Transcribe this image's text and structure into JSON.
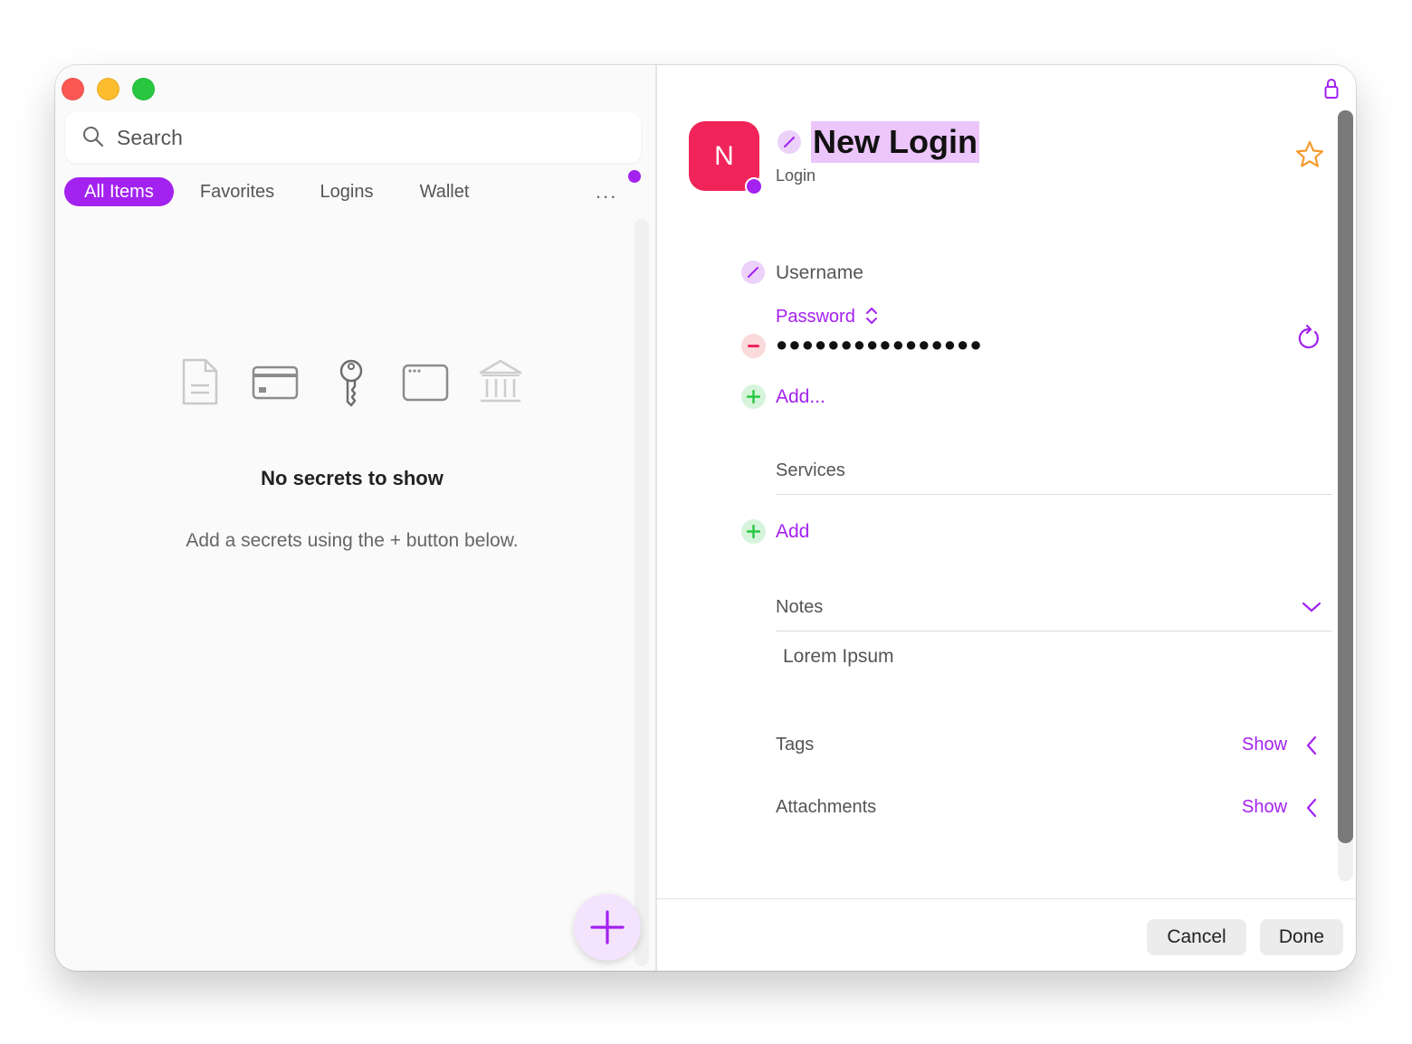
{
  "sidebar": {
    "search_placeholder": "Search",
    "tabs": [
      {
        "label": "All Items",
        "active": true
      },
      {
        "label": "Favorites",
        "active": false
      },
      {
        "label": "Logins",
        "active": false
      },
      {
        "label": "Wallet",
        "active": false
      }
    ],
    "more_label": "...",
    "empty_state": {
      "icons": [
        "document-icon",
        "credit-card-icon",
        "key-icon",
        "browser-window-icon",
        "bank-icon"
      ],
      "title": "No secrets to show",
      "subtitle": "Add a secrets using the + button below."
    }
  },
  "detail": {
    "avatar_letter": "N",
    "title": "New Login",
    "type": "Login",
    "fields": {
      "username_label": "Username",
      "password_label": "Password",
      "password_value": "●●●●●●●●●●●●●●●●",
      "add_field_label": "Add...",
      "services_label": "Services",
      "add_service_label": "Add",
      "notes_label": "Notes",
      "notes_value": "Lorem Ipsum",
      "tags_label": "Tags",
      "tags_action": "Show",
      "attachments_label": "Attachments",
      "attachments_action": "Show"
    }
  },
  "footer": {
    "cancel_label": "Cancel",
    "done_label": "Done"
  },
  "colors": {
    "accent": "#a322ef",
    "avatar": "#f0245a",
    "favorite_star": "#f59a2c",
    "add_green": "#27c840",
    "remove_red": "#f0245a"
  }
}
